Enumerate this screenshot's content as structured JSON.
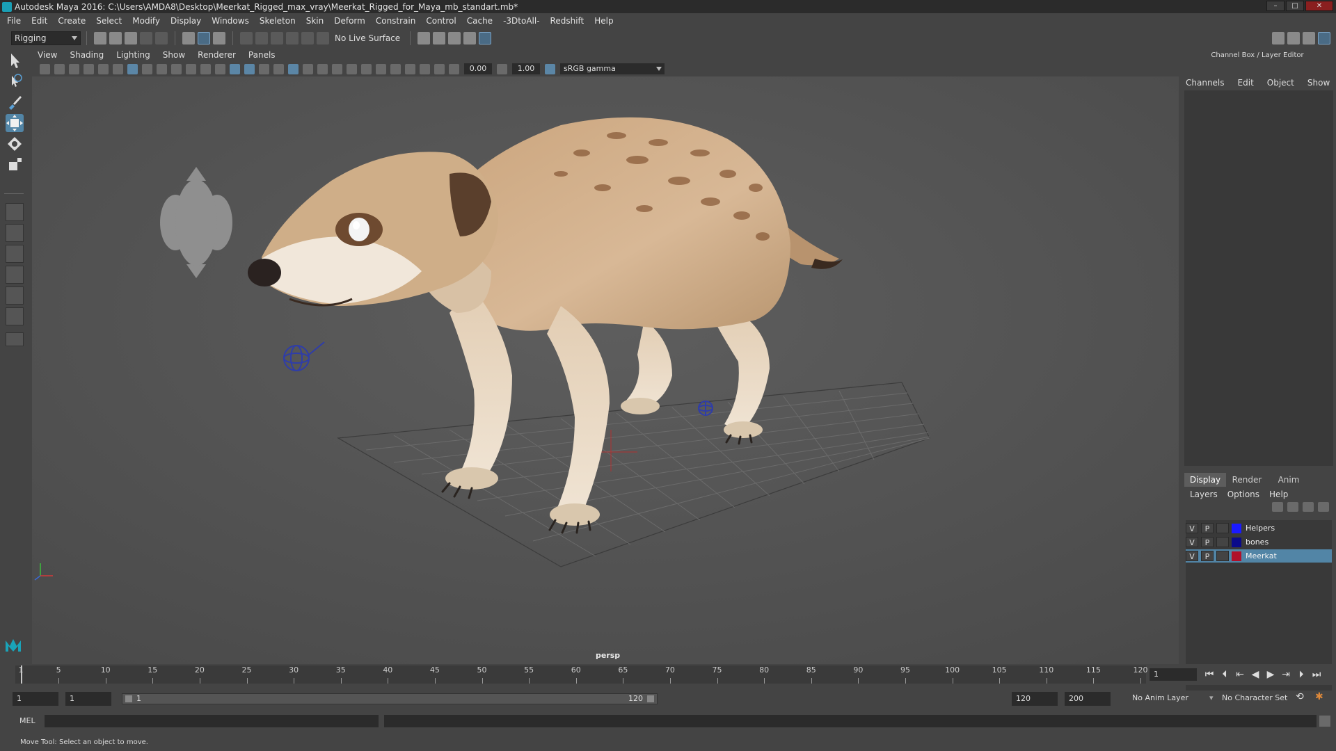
{
  "window": {
    "title": "Autodesk Maya 2016: C:\\Users\\AMDA8\\Desktop\\Meerkat_Rigged_max_vray\\Meerkat_Rigged_for_Maya_mb_standart.mb*"
  },
  "menubar": {
    "items": [
      "File",
      "Edit",
      "Create",
      "Select",
      "Modify",
      "Display",
      "Windows",
      "Skeleton",
      "Skin",
      "Deform",
      "Constrain",
      "Control",
      "Cache",
      "-3DtoAll-",
      "Redshift",
      "Help"
    ]
  },
  "statusline": {
    "mode": "Rigging",
    "live_surface": "No Live Surface"
  },
  "viewport": {
    "menu": [
      "View",
      "Shading",
      "Lighting",
      "Show",
      "Renderer",
      "Panels"
    ],
    "exposure": "0.00",
    "gamma": "1.00",
    "color_space": "sRGB gamma",
    "camera_label": "persp"
  },
  "channelbox": {
    "title": "Channel Box / Layer Editor",
    "menu": [
      "Channels",
      "Edit",
      "Object",
      "Show"
    ]
  },
  "layer_editor": {
    "tabs": [
      "Display",
      "Render",
      "Anim"
    ],
    "menu": [
      "Layers",
      "Options",
      "Help"
    ],
    "layers": [
      {
        "v": "V",
        "p": "P",
        "name": "Helpers",
        "color": "#1a1aff",
        "selected": false
      },
      {
        "v": "V",
        "p": "P",
        "name": "bones",
        "color": "#0a0a8a",
        "selected": false
      },
      {
        "v": "V",
        "p": "P",
        "name": "Meerkat",
        "color": "#b0102a",
        "selected": true
      }
    ]
  },
  "timeline": {
    "ticks": [
      "1",
      "5",
      "10",
      "15",
      "20",
      "25",
      "30",
      "35",
      "40",
      "45",
      "50",
      "55",
      "60",
      "65",
      "70",
      "75",
      "80",
      "85",
      "90",
      "95",
      "100",
      "105",
      "110",
      "115",
      "120"
    ],
    "current_frame": "1"
  },
  "range": {
    "start": "1",
    "playback_start": "1",
    "slider_start": "1",
    "slider_end": "120",
    "playback_end": "120",
    "end": "200",
    "anim_layer": "No Anim Layer",
    "character_set": "No Character Set"
  },
  "commandline": {
    "language": "MEL"
  },
  "helpline": {
    "text": "Move Tool: Select an object to move."
  },
  "colors": {
    "accent": "#5285a6",
    "viewport_bg": "#585858"
  }
}
